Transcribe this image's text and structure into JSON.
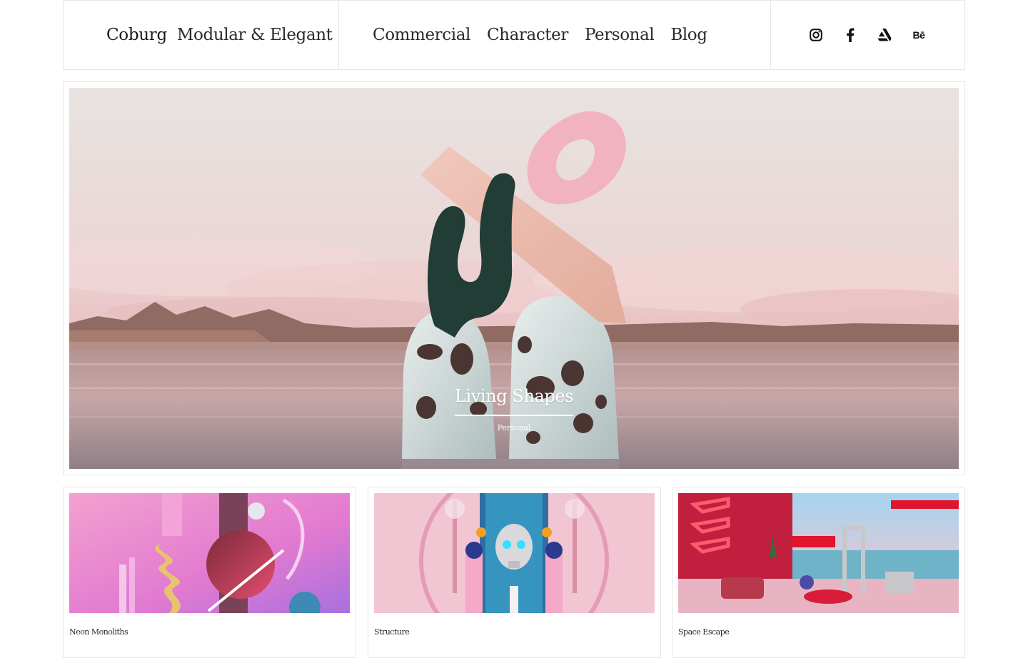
{
  "brand": {
    "name": "Coburg",
    "tagline": "Modular & Elegant"
  },
  "nav": {
    "items": [
      {
        "label": "Commercial"
      },
      {
        "label": "Character"
      },
      {
        "label": "Personal"
      },
      {
        "label": "Blog"
      }
    ]
  },
  "social": {
    "icons": [
      "instagram-icon",
      "facebook-icon",
      "artstation-icon",
      "behance-icon"
    ],
    "behance_label": "Bē"
  },
  "hero": {
    "title": "Living Shapes",
    "category": "Personal"
  },
  "cards": [
    {
      "title": "Neon Monoliths"
    },
    {
      "title": "Structure"
    },
    {
      "title": "Space Escape"
    }
  ],
  "colors": {
    "border": "#e6e6e6",
    "text": "#1c1c1c",
    "hero_sky": "#ead9d6",
    "hero_pink": "#f2b8c4"
  }
}
